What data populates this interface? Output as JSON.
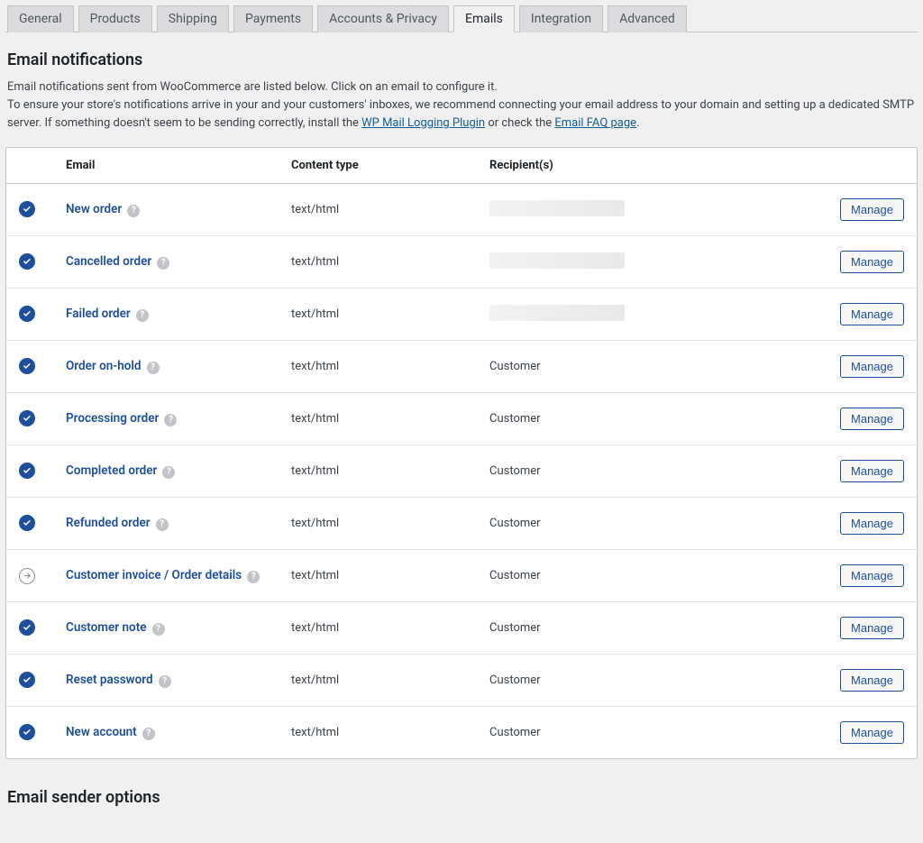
{
  "tabs": [
    {
      "label": "General"
    },
    {
      "label": "Products"
    },
    {
      "label": "Shipping"
    },
    {
      "label": "Payments"
    },
    {
      "label": "Accounts & Privacy"
    },
    {
      "label": "Emails",
      "active": true
    },
    {
      "label": "Integration"
    },
    {
      "label": "Advanced"
    }
  ],
  "section": {
    "title": "Email notifications",
    "intro_line1": "Email notifications sent from WooCommerce are listed below. Click on an email to configure it.",
    "intro_line2_a": "To ensure your store's notifications arrive in your and your customers' inboxes, we recommend connecting your email address to your domain and setting up a dedicated SMTP server. If something doesn't seem to be sending correctly, install the ",
    "intro_link1": "WP Mail Logging Plugin",
    "intro_line2_b": " or check the ",
    "intro_link2": "Email FAQ page",
    "intro_line2_c": "."
  },
  "table": {
    "headers": {
      "email": "Email",
      "content_type": "Content type",
      "recipients": "Recipient(s)"
    },
    "manage_label": "Manage",
    "rows": [
      {
        "status": "on",
        "name": "New order",
        "content_type": "text/html",
        "recipient": "",
        "redacted": true
      },
      {
        "status": "on",
        "name": "Cancelled order",
        "content_type": "text/html",
        "recipient": "",
        "redacted": true
      },
      {
        "status": "on",
        "name": "Failed order",
        "content_type": "text/html",
        "recipient": "",
        "redacted": true
      },
      {
        "status": "on",
        "name": "Order on-hold",
        "content_type": "text/html",
        "recipient": "Customer"
      },
      {
        "status": "on",
        "name": "Processing order",
        "content_type": "text/html",
        "recipient": "Customer"
      },
      {
        "status": "on",
        "name": "Completed order",
        "content_type": "text/html",
        "recipient": "Customer"
      },
      {
        "status": "on",
        "name": "Refunded order",
        "content_type": "text/html",
        "recipient": "Customer"
      },
      {
        "status": "manual",
        "name": "Customer invoice / Order details",
        "content_type": "text/html",
        "recipient": "Customer"
      },
      {
        "status": "on",
        "name": "Customer note",
        "content_type": "text/html",
        "recipient": "Customer"
      },
      {
        "status": "on",
        "name": "Reset password",
        "content_type": "text/html",
        "recipient": "Customer"
      },
      {
        "status": "on",
        "name": "New account",
        "content_type": "text/html",
        "recipient": "Customer"
      }
    ]
  },
  "sender_section_title": "Email sender options"
}
